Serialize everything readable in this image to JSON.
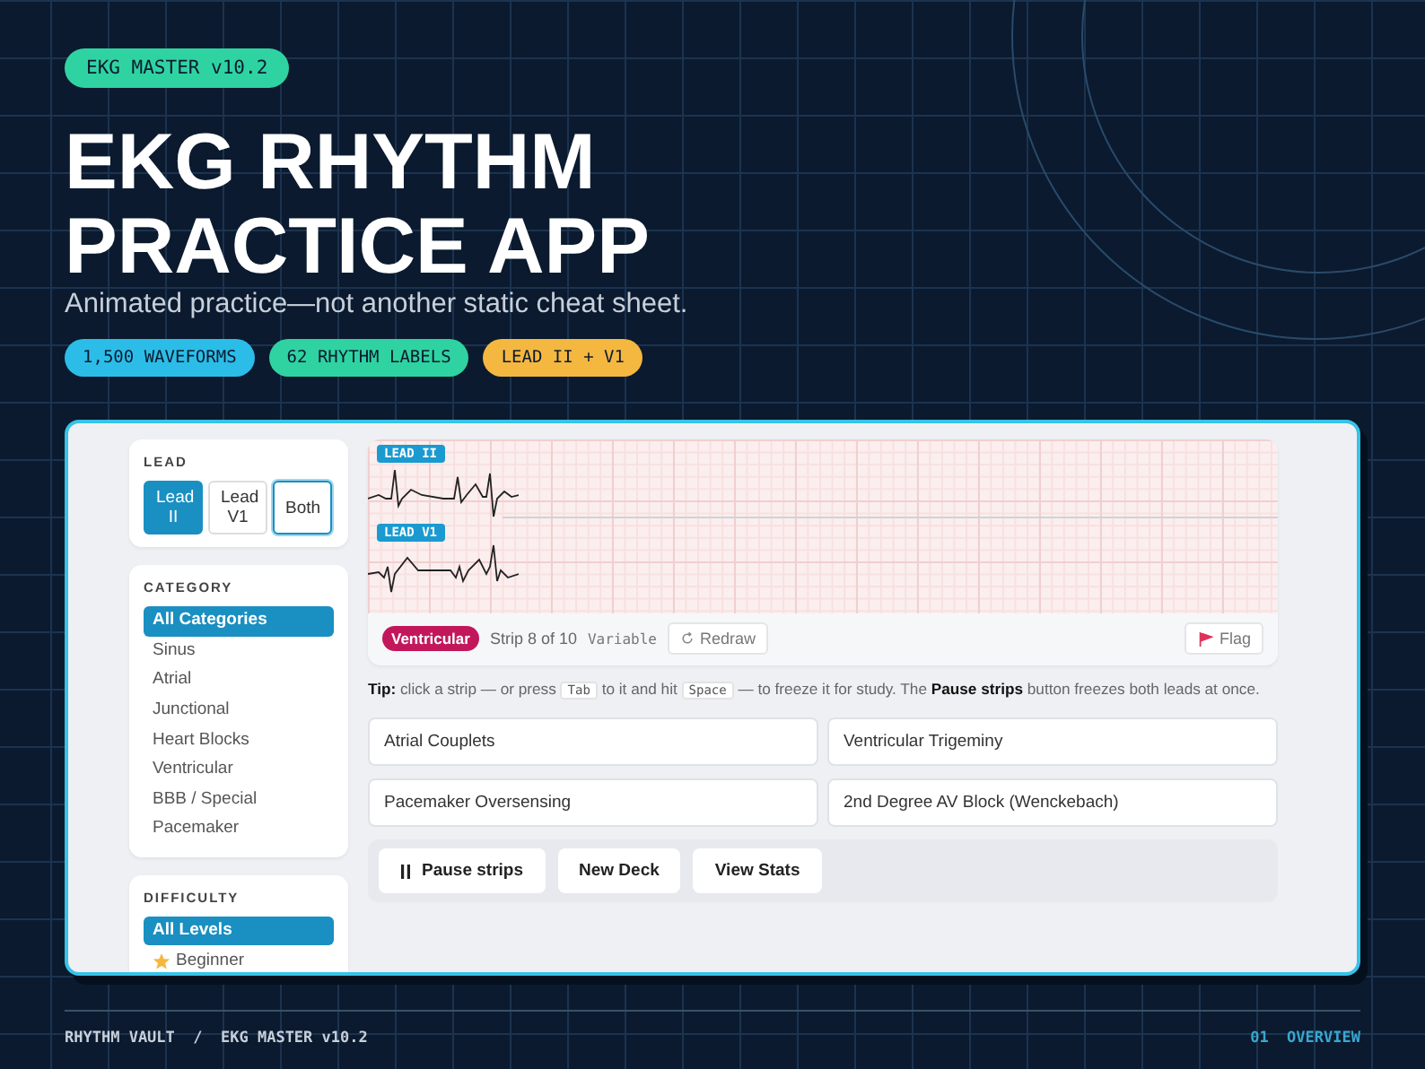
{
  "badge": "EKG MASTER v10.2",
  "title_lines": [
    "EKG RHYTHM",
    "PRACTICE APP"
  ],
  "subtitle": "Animated practice—not another static cheat sheet.",
  "stat_pills": [
    {
      "label": "1,500 WAVEFORMS",
      "color": "#2bbde8"
    },
    {
      "label": "62 RHYTHM LABELS",
      "color": "#2fd3a2"
    },
    {
      "label": "LEAD II + V1",
      "color": "#f4b740"
    }
  ],
  "app": {
    "sidebar": {
      "lead": {
        "heading": "LEAD",
        "options": [
          {
            "label": "Lead II",
            "selected": true,
            "focused": false
          },
          {
            "label": "Lead V1",
            "selected": false,
            "focused": false
          },
          {
            "label": "Both",
            "selected": false,
            "focused": true
          }
        ]
      },
      "category": {
        "heading": "CATEGORY",
        "items": [
          {
            "label": "All Categories",
            "selected": true
          },
          {
            "label": "Sinus",
            "selected": false
          },
          {
            "label": "Atrial",
            "selected": false
          },
          {
            "label": "Junctional",
            "selected": false
          },
          {
            "label": "Heart Blocks",
            "selected": false
          },
          {
            "label": "Ventricular",
            "selected": false
          },
          {
            "label": "BBB / Special",
            "selected": false
          },
          {
            "label": "Pacemaker",
            "selected": false
          }
        ]
      },
      "difficulty": {
        "heading": "DIFFICULTY",
        "items": [
          {
            "label": "All Levels",
            "selected": true,
            "kind": "all"
          },
          {
            "label": "Beginner",
            "selected": false,
            "kind": "level"
          }
        ]
      }
    },
    "strips": [
      {
        "label": "LEAD II",
        "kind": "lead-ii"
      },
      {
        "label": "LEAD V1",
        "kind": "lead-v1"
      }
    ],
    "strip_info": {
      "tag": {
        "label": "Ventricular",
        "color": "#c2185b"
      },
      "counter": "Strip 8 of 10",
      "rate": "Variable",
      "redraw": "Redraw",
      "flag": "Flag"
    },
    "tip": [
      {
        "kind": "text",
        "text": "**Tip:** click a strip — or press"
      },
      {
        "kind": "key",
        "text": "Tab"
      },
      {
        "kind": "text",
        "text": "to it and hit"
      },
      {
        "kind": "key",
        "text": "Space"
      },
      {
        "kind": "text",
        "text": "— to freeze it for study. The **Pause strips** button freezes both leads at once."
      }
    ],
    "answers": [
      "Atrial Couplets",
      "Ventricular Trigeminy",
      "Pacemaker Oversensing",
      "2nd Degree AV Block (Wenckebach)"
    ],
    "actions": [
      {
        "label": "Pause strips",
        "kind": "pause"
      },
      {
        "label": "New Deck",
        "kind": "plain"
      },
      {
        "label": "View Stats",
        "kind": "plain"
      }
    ]
  },
  "footer": {
    "breadcrumb": "RHYTHM VAULT  /  EKG MASTER v10.2",
    "page": "01  OVERVIEW"
  }
}
